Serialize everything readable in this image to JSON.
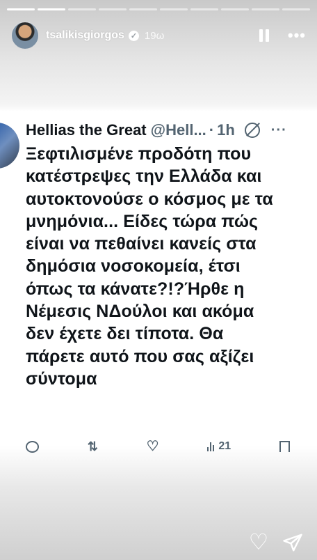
{
  "story": {
    "username": "tsalikisgiorgos",
    "time": "19ω"
  },
  "tweet": {
    "name": "Hellias the Great",
    "handle": "@Hell...",
    "separator": "·",
    "time": "1h",
    "text": "Ξεφτιλισμένε προδότη που\nκατέστρεψες την Ελλάδα και\nαυτοκτονούσε ο κόσμος με τα\nμνημόνια... Είδες τώρα πώς\nείναι να πεθαίνει κανείς στα\nδημόσια νοσοκομεία, έτσι\nόπως τα κάνατε?!?Ήρθε η\nΝέμεσις ΝΔούλοι και ακόμα\nδεν έχετε δει τίποτα. Θα\nπάρετε αυτό που σας αξίζει\nσύντομα",
    "views": "21"
  },
  "icons": {
    "verified": "verified-badge-icon",
    "pause": "pause-icon",
    "more": "more-icon",
    "mute": "mute-icon",
    "reply": "reply-icon",
    "retweet": "retweet-icon",
    "like": "like-icon",
    "views": "views-icon",
    "bookmark": "bookmark-icon",
    "share": "share-icon",
    "story_like": "heart-icon",
    "story_send": "send-icon"
  },
  "colors": {
    "tweet_text": "#0f1419",
    "tweet_secondary": "#536471",
    "story_overlay": "#ffffff"
  }
}
